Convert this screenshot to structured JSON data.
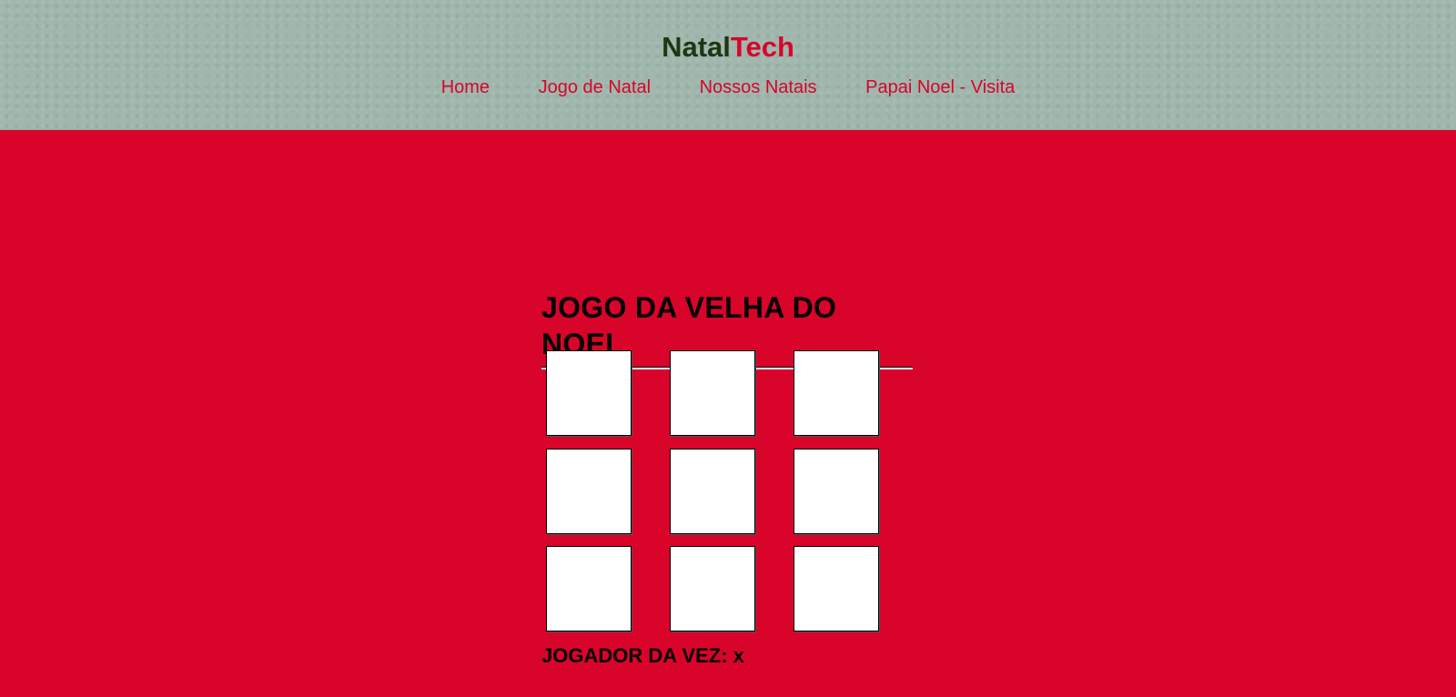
{
  "header": {
    "brand_part1": "Natal",
    "brand_part2": "Tech",
    "nav": [
      "Home",
      "Jogo de Natal",
      "Nossos Natais",
      "Papai Noel - Visita"
    ]
  },
  "game": {
    "title": "JOGO DA VELHA DO NOEL",
    "turn_label": "JOGADOR DA VEZ:",
    "current_player": "x",
    "board": [
      [
        "",
        "",
        ""
      ],
      [
        "",
        "",
        ""
      ],
      [
        "",
        "",
        ""
      ]
    ]
  },
  "colors": {
    "header_bg": "#a0b7ad",
    "page_bg": "#d8042a",
    "brand_dark": "#1d3713",
    "brand_red": "#d8042a"
  }
}
